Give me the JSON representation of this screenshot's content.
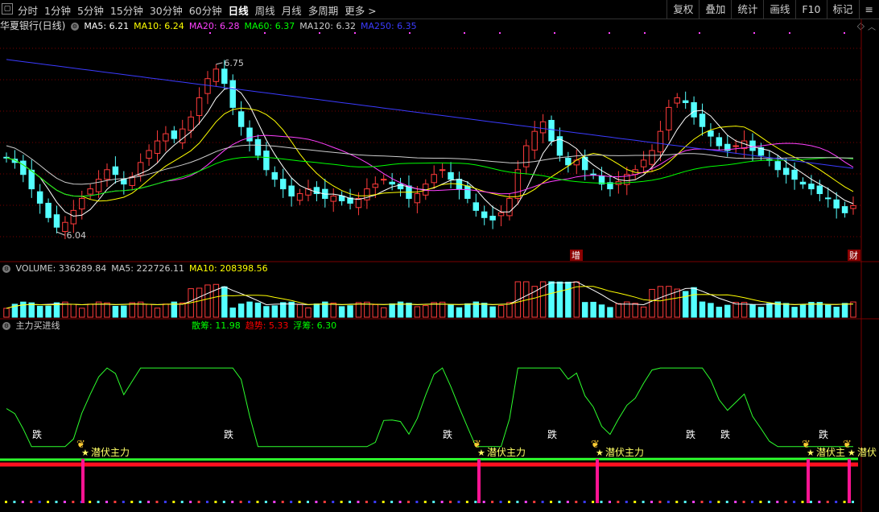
{
  "toolbar": {
    "menu_icon": "menu-square-icon",
    "periods": [
      "分时",
      "1分钟",
      "5分钟",
      "15分钟",
      "30分钟",
      "60分钟",
      "日线",
      "周线",
      "月线",
      "多周期",
      "更多 >"
    ],
    "active_period": "日线",
    "tools": [
      "复权",
      "叠加",
      "统计",
      "画线",
      "F10",
      "标记",
      "≡"
    ]
  },
  "main_pane": {
    "title": "华夏银行(日线)",
    "ma_items": [
      {
        "label": "MA5: 6.21",
        "color": "#ffffff"
      },
      {
        "label": "MA10: 6.24",
        "color": "#ffff00"
      },
      {
        "label": "MA20: 6.28",
        "color": "#ff40ff"
      },
      {
        "label": "MA60: 6.37",
        "color": "#00ff00"
      },
      {
        "label": "MA120: 6.32",
        "color": "#cccccc"
      },
      {
        "label": "MA250: 6.35",
        "color": "#3b3bff"
      }
    ],
    "high_label": "6.75",
    "low_label": "6.04",
    "event_labels": [
      "增",
      "财"
    ],
    "collapse_icon": "diamond-icon"
  },
  "volume_pane": {
    "items": [
      {
        "label": "VOLUME: 336289.84",
        "color": "#cccccc"
      },
      {
        "label": "MA5: 222726.11",
        "color": "#cccccc"
      },
      {
        "label": "MA10: 208398.56",
        "color": "#ffff00"
      }
    ]
  },
  "indicator_pane": {
    "title": "主力买进线",
    "items": [
      {
        "label": "散筹: 11.98",
        "color": "#00ff00"
      },
      {
        "label": "趋势: 5.33",
        "color": "#ff0000"
      },
      {
        "label": "浮筹: 6.30",
        "color": "#00ff00"
      }
    ],
    "die_label": "跌",
    "signal_label": "潜伏主力",
    "signal_label_short": "潜伏主",
    "signal_label_cut": "潜伏"
  },
  "colors": {
    "up": "#ff3b3b",
    "down": "#54ffff",
    "grid": "#7a0000"
  }
}
